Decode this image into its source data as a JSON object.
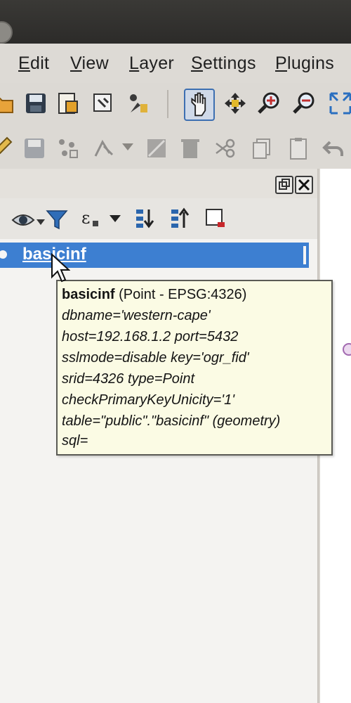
{
  "menubar": {
    "items": [
      {
        "label": "Edit",
        "accel": "E",
        "rest": "dit"
      },
      {
        "label": "View",
        "accel": "V",
        "rest": "iew"
      },
      {
        "label": "Layer",
        "accel": "L",
        "rest": "ayer"
      },
      {
        "label": "Settings",
        "accel": "S",
        "rest": "ettings"
      },
      {
        "label": "Plugins",
        "accel": "P",
        "rest": "lugins"
      }
    ]
  },
  "toolbar1": {
    "icons": [
      "open-project-icon",
      "save-project-icon",
      "new-print-layout-icon",
      "layout-manager-icon",
      "style-manager-icon",
      "pan-map-icon",
      "pan-to-selection-icon",
      "zoom-in-icon",
      "zoom-out-icon",
      "zoom-full-icon"
    ]
  },
  "toolbar2": {
    "icons": [
      "edit-pencil-icon",
      "save-layer-edits-icon",
      "digitize-points-icon",
      "vertex-tool-icon",
      "delete-selected-icon",
      "cut-features-icon",
      "copy-features-icon",
      "paste-features-icon",
      "undo-icon"
    ]
  },
  "layers_panel": {
    "toolbar_icons": [
      "visibility-eye-icon",
      "filter-legend-icon",
      "expression-filter-icon",
      "expand-all-icon",
      "collapse-all-icon",
      "remove-layer-icon"
    ],
    "layers": [
      {
        "name": "basicinf",
        "selected": true
      }
    ]
  },
  "tooltip": {
    "title_bold": "basicinf",
    "title_rest": " (Point - EPSG:4326)",
    "lines": [
      "dbname='western-cape'",
      "host=192.168.1.2 port=5432",
      "sslmode=disable key='ogr_fid'",
      "srid=4326 type=Point",
      "checkPrimaryKeyUnicity='1'",
      "table=\"public\".\"basicinf\" (geometry)",
      "sql="
    ]
  },
  "colors": {
    "selection": "#3d7fd1",
    "tooltip_bg": "#fbfbe4",
    "menubar_bg": "#dddad5"
  }
}
